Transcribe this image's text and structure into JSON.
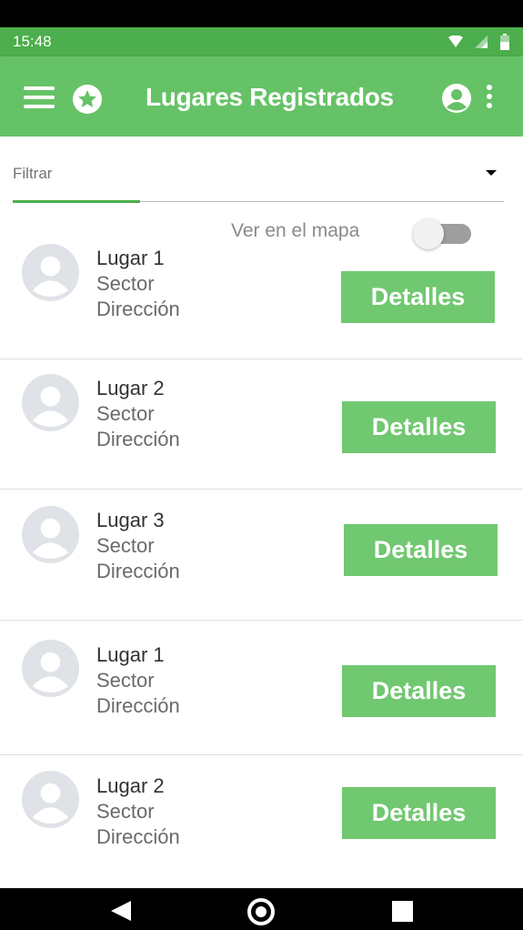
{
  "status_bar": {
    "time": "15:48",
    "icons": [
      "wifi-icon",
      "cell-signal-icon",
      "battery-icon"
    ],
    "background": "#4cae4c"
  },
  "app_bar": {
    "title": "Lugares Registrados",
    "background": "#66c266",
    "icons": [
      "menu-icon",
      "star-icon",
      "account-circle-icon",
      "more-vert-icon"
    ]
  },
  "filter": {
    "label": "Filtrar",
    "accent": "#4cae4c"
  },
  "map_toggle": {
    "label": "Ver en el mapa",
    "on": false
  },
  "places": [
    {
      "name": "Lugar 1",
      "sector": "Sector",
      "address": "Dirección",
      "button": "Detalles"
    },
    {
      "name": "Lugar 2",
      "sector": "Sector",
      "address": "Dirección",
      "button": "Detalles"
    },
    {
      "name": "Lugar 3",
      "sector": "Sector",
      "address": "Dirección",
      "button": "Detalles"
    },
    {
      "name": "Lugar 1",
      "sector": "Sector",
      "address": "Dirección",
      "button": "Detalles"
    },
    {
      "name": "Lugar 2",
      "sector": "Sector",
      "address": "Dirección",
      "button": "Detalles"
    }
  ],
  "colors": {
    "button": "#70c870",
    "avatar": "#dfe2e6"
  },
  "nav_bar": {
    "icons": [
      "back-icon",
      "home-icon",
      "recents-icon"
    ]
  }
}
